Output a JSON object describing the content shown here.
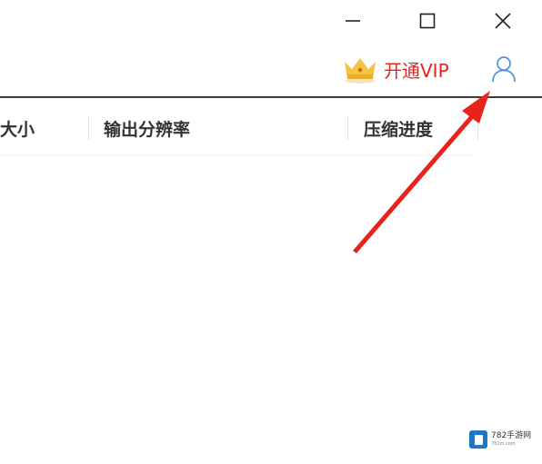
{
  "window_controls": {
    "minimize_icon": "minimize-icon",
    "maximize_icon": "maximize-icon",
    "close_icon": "close-icon"
  },
  "header": {
    "vip_label": "开通VIP",
    "vip_icon": "crown-icon",
    "user_icon": "user-icon",
    "accent_color": "#e02424"
  },
  "table": {
    "columns": [
      "大小",
      "输出分辨率",
      "压缩进度"
    ]
  },
  "annotation": {
    "arrow_color": "#e8231e"
  },
  "watermark": {
    "title": "782手游网",
    "subtitle": "782m.com"
  }
}
